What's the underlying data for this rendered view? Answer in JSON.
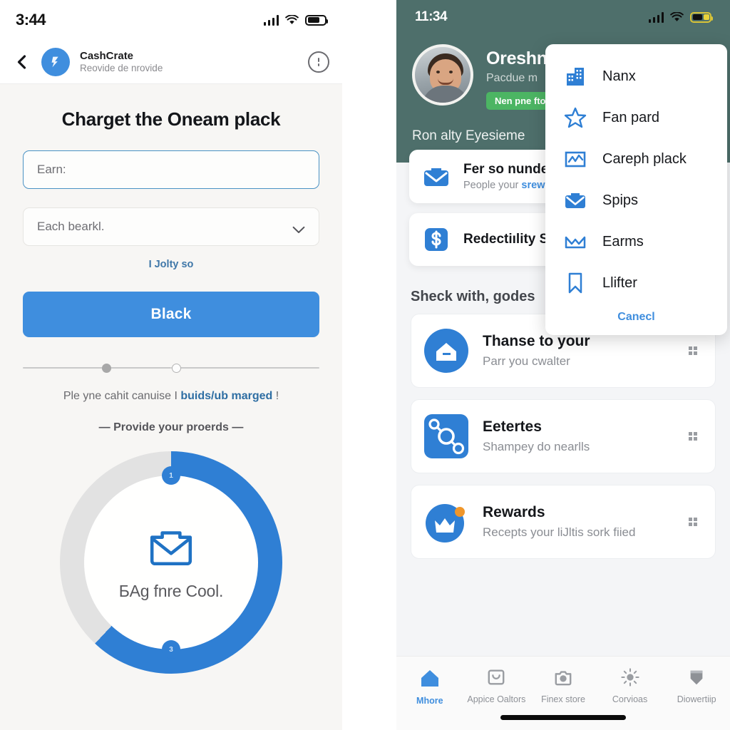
{
  "left": {
    "status": {
      "time": "3:44",
      "signal_icon": "signal-bars-icon",
      "wifi_icon": "wifi-icon",
      "battery_icon": "battery-icon"
    },
    "appbar": {
      "back_icon": "back-chevron-icon",
      "avatar_icon": "brand-avatar-icon",
      "brand_name": "CashCrate",
      "brand_sub": "Reovide de nrovide",
      "info_icon": "info-circle-icon"
    },
    "hero_title": "Charget the Oneam plack",
    "input": {
      "value": "Earn:",
      "placeholder": "Earn:"
    },
    "select": {
      "value": "Each bearkl.",
      "chevron_icon": "chevron-down-icon"
    },
    "helper_link": "I Jolty so",
    "cta_label": "Black",
    "note": {
      "prefix": "Ple yne cahit canuise I ",
      "link": "buids/ub marged",
      "suffix": " !"
    },
    "divider_label": "— Provide your proerds —",
    "donut": {
      "center_icon": "envelope-icon",
      "center_label": "БAg fnre Cool.",
      "node_top": "1",
      "node_bottom": "3",
      "progress_percent": 62,
      "progress_color": "#2f7fd4",
      "track_color": "#e2e2e2"
    }
  },
  "right": {
    "status": {
      "time": "11:34",
      "signal_icon": "signal-bars-icon",
      "wifi_icon": "wifi-icon",
      "battery_icon": "battery-low-power-icon"
    },
    "hero": {
      "avatar_icon": "user-photo-avatar",
      "name": "Oreshndly Chonsite",
      "sub": "Pacdue m",
      "badge": "Nen pne ftoc",
      "action_icon": "card-outline-icon",
      "section_title": "Ron alty Eyesieme",
      "background_color": "#4e6f6b"
    },
    "mini_cards": [
      {
        "icon": "envelope-icon",
        "title": "Fer so nunde",
        "sub_prefix": "People your ",
        "sub_link": "srew"
      },
      {
        "icon": "dollar-square-icon",
        "title": "Redectiılity S",
        "sub_prefix": "",
        "sub_link": ""
      }
    ],
    "sub_head": "Sheck with, godes",
    "big_cards": [
      {
        "icon": "home-circle-icon",
        "title": "Thanse to your",
        "sub": "Parr you cwalter",
        "grip_icon": "grid-grip-icon",
        "badge": false
      },
      {
        "icon": "network-square-icon",
        "title": "Eetertes",
        "sub": "Shampey do nearlls",
        "grip_icon": "grid-grip-icon",
        "badge": false
      },
      {
        "icon": "crown-circle-icon",
        "title": "Rewards",
        "sub": "Recepts your liJltis sork fiied",
        "grip_icon": "grid-grip-icon",
        "badge": true
      }
    ],
    "tabs": [
      {
        "label": "Mhore",
        "icon": "home-icon",
        "active": true
      },
      {
        "label": "Appice Oaltors",
        "icon": "calendar-icon",
        "active": false
      },
      {
        "label": "Finex store",
        "icon": "camera-icon",
        "active": false
      },
      {
        "label": "Corvioas",
        "icon": "sun-icon",
        "active": false
      },
      {
        "label": "Diowertiip",
        "icon": "shield-icon",
        "active": false
      }
    ]
  },
  "dropdown": {
    "items": [
      {
        "label": "Nanx",
        "icon": "building-icon"
      },
      {
        "label": "Fan pard",
        "icon": "star-icon"
      },
      {
        "label": "Careph plack",
        "icon": "chart-frame-icon"
      },
      {
        "label": "Spips",
        "icon": "envelope-icon"
      },
      {
        "label": "Earms",
        "icon": "mountain-icon"
      },
      {
        "label": "Llifter",
        "icon": "bookmark-icon"
      }
    ],
    "cancel_label": "Canecl"
  },
  "colors": {
    "accent": "#3f8ede",
    "teal": "#4e6f6b",
    "green": "#4cb563",
    "link": "#3f77a8"
  }
}
